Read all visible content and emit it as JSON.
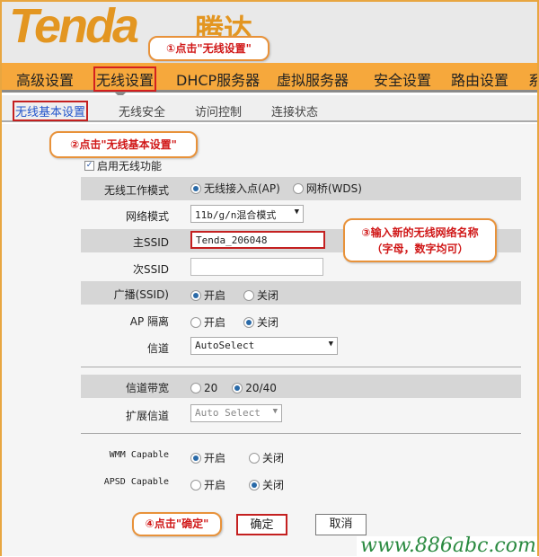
{
  "logo": {
    "brand": "Tenda",
    "brand_cn": "腾达"
  },
  "nav": {
    "items": [
      "高级设置",
      "无线设置",
      "DHCP服务器",
      "虚拟服务器",
      "安全设置",
      "路由设置",
      "系"
    ],
    "active": "无线设置"
  },
  "subnav": {
    "items": [
      "无线基本设置",
      "无线安全",
      "访问控制",
      "连接状态"
    ],
    "active": "无线基本设置"
  },
  "form": {
    "enable_wireless": {
      "label": "启用无线功能",
      "checked": true
    },
    "work_mode": {
      "label": "无线工作模式",
      "options": [
        "无线接入点(AP)",
        "网桥(WDS)"
      ],
      "selected": "无线接入点(AP)"
    },
    "net_mode": {
      "label": "网络模式",
      "value": "11b/g/n混合模式"
    },
    "ssid1": {
      "label": "主SSID",
      "value": "Tenda_206048"
    },
    "ssid2": {
      "label": "次SSID",
      "value": ""
    },
    "broadcast": {
      "label": "广播(SSID)",
      "options": [
        "开启",
        "关闭"
      ],
      "selected": "开启"
    },
    "ap_isolation": {
      "label": "AP 隔离",
      "options": [
        "开启",
        "关闭"
      ],
      "selected": "关闭"
    },
    "channel": {
      "label": "信道",
      "value": "AutoSelect"
    },
    "bandwidth": {
      "label": "信道带宽",
      "options": [
        "20",
        "20/40"
      ],
      "selected": "20/40"
    },
    "ext_channel": {
      "label": "扩展信道",
      "value": "Auto Select"
    },
    "wmm": {
      "label": "WMM Capable",
      "options": [
        "开启",
        "关闭"
      ],
      "selected": "开启"
    },
    "apsd": {
      "label": "APSD Capable",
      "options": [
        "开启",
        "关闭"
      ],
      "selected": "关闭"
    },
    "ok_label": "确定",
    "cancel_label": "取消"
  },
  "callouts": {
    "step1": "①点击\"无线设置\"",
    "step2": "②点击\"无线基本设置\"",
    "step3_line1": "③输入新的无线网络名称",
    "step3_line2": "（字母，数字均可）",
    "step4": "④点击\"确定\""
  },
  "watermark": "www.886abc.com",
  "colors": {
    "nav": "#f6a83c",
    "highlight": "#d42020",
    "callout_border": "#e8923a"
  }
}
